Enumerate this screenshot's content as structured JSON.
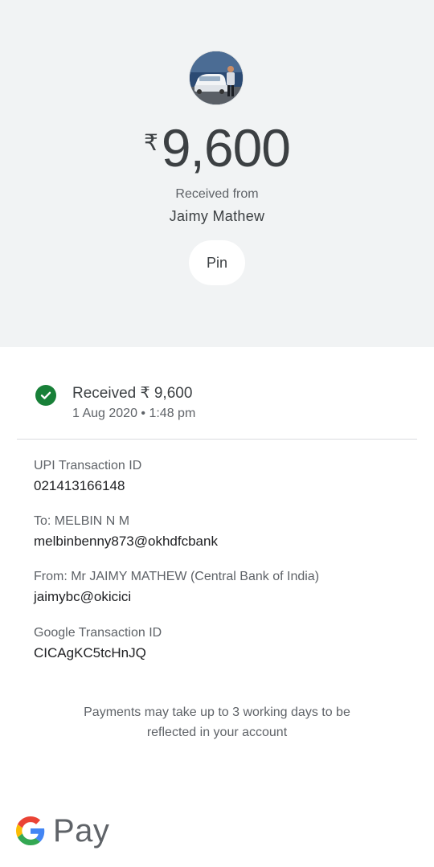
{
  "header": {
    "currency_symbol": "₹",
    "amount": "9,600",
    "received_from_label": "Received from",
    "sender_name": "Jaimy Mathew",
    "pin_label": "Pin"
  },
  "status": {
    "icon": "check-circle-icon",
    "title": "Received ₹ 9,600",
    "datetime": "1 Aug 2020 • 1:48 pm",
    "color": "#188038"
  },
  "details": [
    {
      "label": "UPI Transaction ID",
      "value": "021413166148"
    },
    {
      "label": "To: MELBIN N M",
      "value": "melbinbenny873@okhdfcbank"
    },
    {
      "label": "From: Mr JAIMY  MATHEW (Central Bank of India)",
      "value": "jaimybc@okicici"
    },
    {
      "label": "Google Transaction ID",
      "value": "CICAgKC5tcHnJQ"
    }
  ],
  "note": {
    "line1": "Payments may take up to 3 working days to be",
    "line2": "reflected in your account"
  },
  "brand": {
    "text": "Pay",
    "logo": "google-g-logo",
    "colors": {
      "blue": "#4285F4",
      "red": "#EA4335",
      "yellow": "#FBBC05",
      "green": "#34A853"
    }
  }
}
